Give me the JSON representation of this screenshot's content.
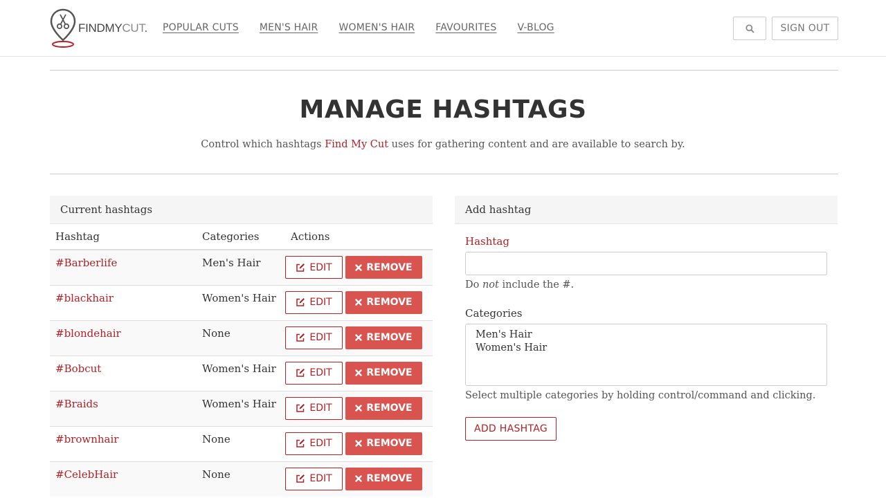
{
  "brand": {
    "find": "FIND",
    "my": "MY",
    "cut": "CUT",
    "dot": ".",
    "accent_color": "#b52025"
  },
  "nav": {
    "links": [
      "POPULAR CUTS",
      "MEN'S HAIR",
      "WOMEN'S HAIR",
      "FAVOURITES",
      "V-BLOG"
    ],
    "search_icon": "search-icon",
    "signout_label": "SIGN OUT"
  },
  "page": {
    "title": "MANAGE HASHTAGS",
    "subtitle_before": "Control which hashtags ",
    "subtitle_brand": "Find My Cut",
    "subtitle_after": " uses for gathering content and are available to search by."
  },
  "current_panel": {
    "heading": "Current hashtags",
    "columns": [
      "Hashtag",
      "Categories",
      "Actions"
    ],
    "edit_label": "EDIT",
    "remove_label": "REMOVE",
    "edit_icon": "edit-icon",
    "remove_icon": "times-icon",
    "rows": [
      {
        "hashtag": "#Barberlife",
        "categories": "Men's Hair"
      },
      {
        "hashtag": "#blackhair",
        "categories": "Women's Hair"
      },
      {
        "hashtag": "#blondehair",
        "categories": "None"
      },
      {
        "hashtag": "#Bobcut",
        "categories": "Women's Hair"
      },
      {
        "hashtag": "#Braids",
        "categories": "Women's Hair"
      },
      {
        "hashtag": "#brownhair",
        "categories": "None"
      },
      {
        "hashtag": "#CelebHair",
        "categories": "None"
      }
    ]
  },
  "add_panel": {
    "heading": "Add hashtag",
    "hashtag_label": "Hashtag",
    "hashtag_value": "",
    "hashtag_help_before": "Do ",
    "hashtag_help_em": "not",
    "hashtag_help_after": " include the #.",
    "categories_label": "Categories",
    "category_options": [
      "Men's Hair",
      "Women's Hair"
    ],
    "categories_help": "Select multiple categories by holding control/command and clicking.",
    "submit_label": "ADD HASHTAG"
  }
}
